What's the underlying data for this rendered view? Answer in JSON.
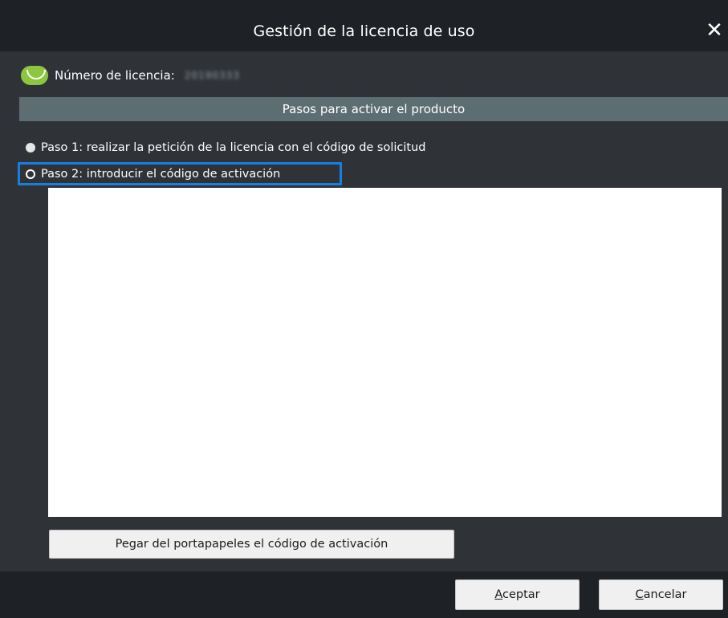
{
  "window": {
    "title": "Gestión de la licencia de uso",
    "close_glyph": "✕"
  },
  "license": {
    "label": "Número de licencia:",
    "value": "20190333",
    "logo_icon": "license-badge-icon",
    "logo_color": "#8dc63f"
  },
  "steps": {
    "header": "Pasos para activar el producto",
    "items": [
      {
        "label": "Paso 1: realizar la petición de la licencia con el código de solicitud",
        "selected": true
      },
      {
        "label": "Paso 2: introducir el código de activación",
        "selected": false,
        "focused": true
      }
    ]
  },
  "activation": {
    "code_value": "",
    "paste_button_label": "Pegar del portapapeles el código de activación"
  },
  "footer": {
    "accept": {
      "mnemonic": "A",
      "rest": "ceptar"
    },
    "cancel": {
      "mnemonic": "C",
      "rest": "ancelar"
    }
  },
  "colors": {
    "background": "#1e2125",
    "panel": "#2f3338",
    "header_bar": "#5d6e72",
    "focus_outline": "#1a7de0"
  }
}
